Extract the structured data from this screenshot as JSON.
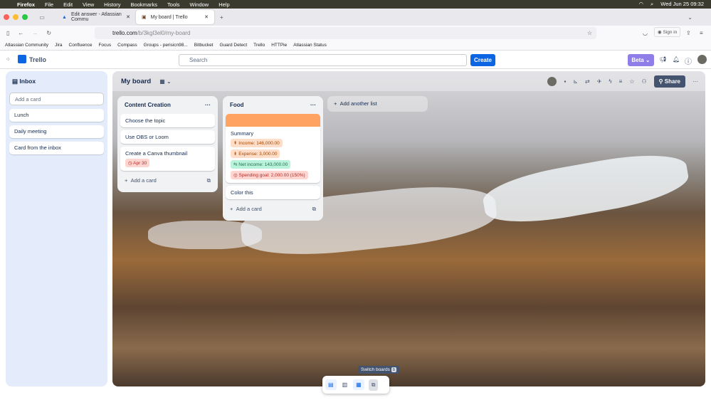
{
  "menubar": {
    "items": [
      "Firefox",
      "File",
      "Edit",
      "View",
      "History",
      "Bookmarks",
      "Tools",
      "Window",
      "Help"
    ],
    "clock": "Wed Jun 25  09:32"
  },
  "tabs": [
    {
      "label": "Edit answer - Atlassian Commu"
    },
    {
      "label": "My board | Trello"
    }
  ],
  "url": {
    "host": "trello.com",
    "path": "/b/3kgl3el0/my-board"
  },
  "signin": "Sign in",
  "bookmarks": [
    "Atlassian Community",
    "Jira",
    "Confluence",
    "Focus",
    "Compass",
    "Groups - perisicn98...",
    "Bitbucket",
    "Guard Detect",
    "Trello",
    "HTTPie",
    "Atlassian Status"
  ],
  "app": {
    "name": "Trello",
    "search_placeholder": "Search",
    "create": "Create",
    "beta": "Beta"
  },
  "inbox": {
    "title": "Inbox",
    "add_placeholder": "Add a card",
    "cards": [
      "Lunch",
      "Daily meeting",
      "Card from the inbox"
    ]
  },
  "board": {
    "title": "My board",
    "share": "Share",
    "add_list": "Add another list",
    "lists": [
      {
        "title": "Content Creation",
        "cards": [
          {
            "title": "Choose the topic"
          },
          {
            "title": "Use OBS or Loom"
          },
          {
            "title": "Create a Canva thumbnail",
            "due": "Apr 30"
          }
        ],
        "add": "Add a card"
      },
      {
        "title": "Food",
        "cover": "#fea362",
        "summary": {
          "title": "Summary",
          "income": "Income: 146,000.00",
          "expense": "Expense: 3,000.00",
          "net": "Net income: 143,000.00",
          "goal": "Spending goal: 2,000.00 (150%)"
        },
        "cards": [
          {
            "title": "Color this"
          }
        ],
        "add": "Add a card"
      }
    ]
  },
  "tooltip": {
    "label": "Switch boards",
    "key": "b"
  }
}
